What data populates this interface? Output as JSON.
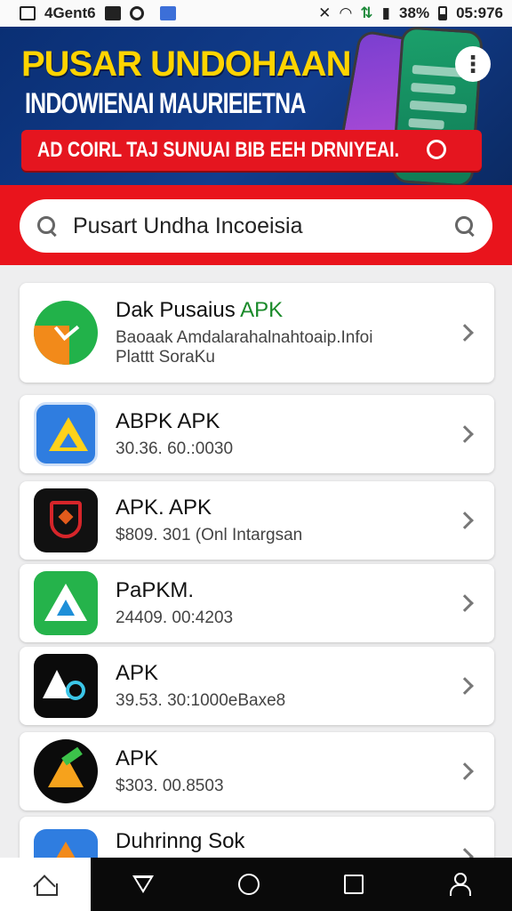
{
  "status_bar": {
    "left_text": "4Gent6",
    "battery": "38%",
    "time": "05:976"
  },
  "banner": {
    "title": "PUSAR UNDOHAAN",
    "subtitle": "INDOWIENAI MAURIEIETNA",
    "cta": "AD COIRL TAJ SUNUAI BIB EEH DRNIYEAI.",
    "menu_icon": "more-vertical-icon",
    "colors": {
      "background": "#0a2f74",
      "title": "#ffd400",
      "cta": "#e5151f"
    }
  },
  "search": {
    "value": "Pusart Undha Incoeisia",
    "icon": "search-icon"
  },
  "apps": [
    {
      "name": "Dak Pusaius",
      "tag": "APK",
      "meta_line1": "Baoaak Amdalarahalnahtoaip.Infoi",
      "meta_line2": "Plattt SoraKu",
      "icon": "green-chat-icon"
    },
    {
      "name": "ABPK APK",
      "tag": "",
      "meta_line1": "30.36. 60.:0030",
      "meta_line2": "",
      "icon": "blue-triangle-icon"
    },
    {
      "name": "APK. APK",
      "tag": "",
      "meta_line1": "$809. 301 (Onl Intargsan",
      "meta_line2": "",
      "icon": "shield-game-icon"
    },
    {
      "name": "PaPKM.",
      "tag": "",
      "meta_line1": "24409. 00:4203",
      "meta_line2": "",
      "icon": "green-triangle-icon"
    },
    {
      "name": "APK",
      "tag": "",
      "meta_line1": "39.53. 30:1000eBaxe8",
      "meta_line2": "",
      "icon": "black-logo-icon"
    },
    {
      "name": "APK",
      "tag": "",
      "meta_line1": "$303. 00.8503",
      "meta_line2": "",
      "icon": "orange-arrow-icon"
    },
    {
      "name": "Duhrinng Sok",
      "tag": "",
      "meta_line1": "",
      "meta_line2": "",
      "icon": "blue-triangle-icon"
    }
  ],
  "nav": {
    "home": "home-icon",
    "back": "back-icon",
    "circle": "home-circle-icon",
    "recents": "recents-icon",
    "profile": "profile-icon"
  }
}
